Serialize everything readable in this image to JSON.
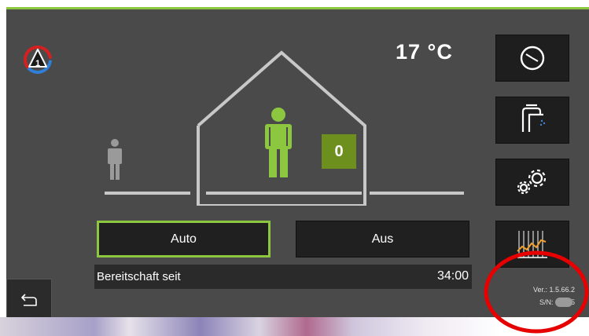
{
  "header": {
    "zone_number": "1",
    "temperature": "17 °C"
  },
  "house": {
    "occupancy_count": "0"
  },
  "modes": {
    "auto_label": "Auto",
    "off_label": "Aus",
    "active": "Auto"
  },
  "status": {
    "label": "Bereitschaft seit",
    "time": "34:00"
  },
  "sidebar": {
    "buttons": [
      {
        "name": "clock",
        "icon": "clock-icon"
      },
      {
        "name": "hot-water",
        "icon": "faucet-icon"
      },
      {
        "name": "settings",
        "icon": "gears-icon"
      },
      {
        "name": "chart",
        "icon": "chart-icon"
      }
    ]
  },
  "footer": {
    "version": "Ver.: 1.5.66.2",
    "serial": "S/N: 01945"
  },
  "colors": {
    "accent_green": "#8dc63f",
    "panel_bg": "#4a4a4a",
    "button_bg": "#1e1e1e",
    "annotation_red": "#e60000"
  }
}
